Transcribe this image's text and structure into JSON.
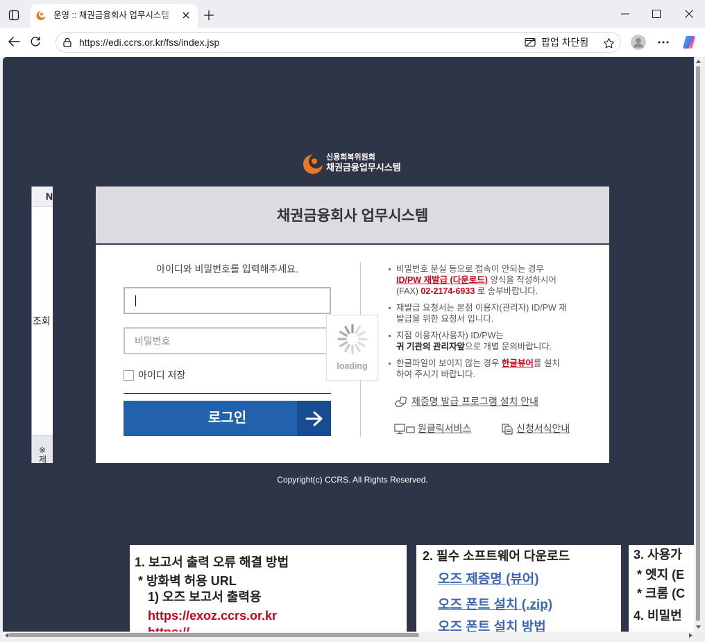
{
  "browser": {
    "tab_title": "운영 :: 채권금융회사 업무시스템",
    "url": "https://edi.ccrs.or.kr/fss/index.jsp",
    "popup_blocked_label": "팝업 차단됨"
  },
  "logo": {
    "org_name": "신용회복위원회",
    "system_name": "채권금융업무시스템"
  },
  "login": {
    "title": "채권금융회사 업무시스템",
    "instruction": "아이디와 비밀번호를 입력해주세요.",
    "id_value": "",
    "password_placeholder": "비밀번호",
    "remember_id_label": "아이디 저장",
    "remember_id_checked": false,
    "submit_label": "로그인"
  },
  "loading_label": "loading",
  "notices": [
    {
      "lines": [
        [
          "비밀번호 분실 등으로 접속이 안되는 경우"
        ],
        [
          "ID/PW 재발급 (다운로드)",
          " 양식을 작성하시어"
        ],
        [
          "(FAX) ",
          "02-2174-6933",
          " 로 송부바랍니다."
        ]
      ]
    },
    {
      "lines": [
        [
          "재발급 요청서는 본점 이용자(관리자) ID/PW 재"
        ],
        [
          "발급을 위한 요청서 입니다."
        ]
      ]
    },
    {
      "lines": [
        [
          "지점 이용자(사용자) ID/PW는"
        ],
        [
          "귀 기관의 관리자앞",
          "으로 개별 문의바랍니다."
        ]
      ]
    },
    {
      "lines": [
        [
          "한글파일이 보이지 않는 경우 ",
          "한글뷰어",
          "를 설치"
        ],
        [
          "하여 주시기 바랍니다."
        ]
      ]
    }
  ],
  "links": [
    {
      "label": "제증명 발급 프로그램 설치 안내",
      "icon": "certificate-program-icon"
    },
    {
      "label": "원클릭서비스",
      "icon": "one-click-monitor-icon"
    },
    {
      "label": "신청서식안내",
      "icon": "application-form-icon"
    }
  ],
  "copyright": "Copyright(c) CCRS. All Rights Reserved.",
  "background_table": {
    "header": "N",
    "row_text": "조회",
    "footer_lines": [
      "※",
      "제"
    ]
  },
  "guide_panels": [
    {
      "lines": [
        "1. 보고서 출력 오류 해결 방법",
        " * 방화벽 허용 URL",
        "1) 오즈 보고서 출력용",
        "https://exoz.ccrs.or.kr",
        "https://"
      ]
    },
    {
      "title": "2. 필수 소프트웨어 다운로드",
      "links": [
        "오즈 제증명 (뷰어)",
        "오즈 폰트 설치 (.zip)",
        "오즈 폰트 설치 방법"
      ]
    },
    {
      "lines": [
        "3. 사용가",
        " * 엣지 (E",
        " * 크롬 (C",
        "4. 비밀번"
      ]
    }
  ],
  "colors": {
    "page_background": "#2f3548",
    "login_button": "#2262ad",
    "login_button_arrow": "#184c90",
    "alert_red": "#d0021b",
    "brand_orange": "#ea7a1c",
    "guide_link_blue": "#3b67b2"
  }
}
